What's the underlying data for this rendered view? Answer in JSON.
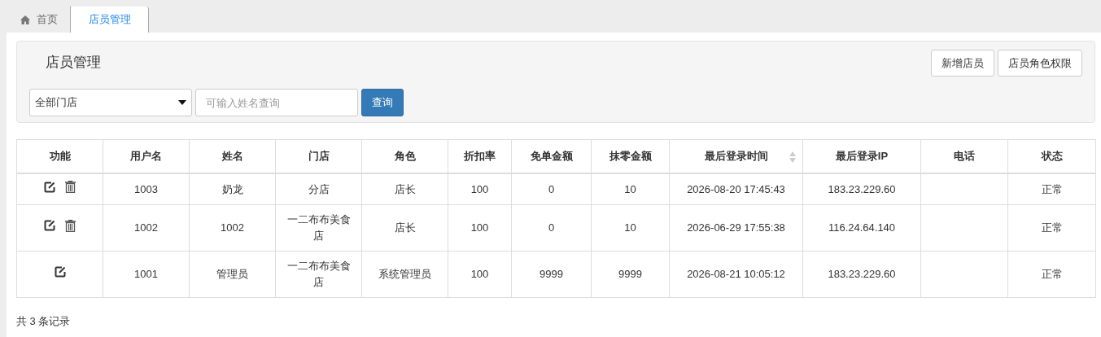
{
  "tabs": [
    {
      "label": "首页",
      "selected": false
    },
    {
      "label": "店员管理",
      "selected": true
    }
  ],
  "panel": {
    "title": "店员管理",
    "buttons": [
      "新增店员",
      "店员角色权限"
    ],
    "store_select": {
      "value": "全部门店"
    },
    "name_search": {
      "placeholder": "可输入姓名查询"
    },
    "query_button": "查询"
  },
  "table": {
    "columns": [
      {
        "label": "功能"
      },
      {
        "label": "用户名"
      },
      {
        "label": "姓名"
      },
      {
        "label": "门店"
      },
      {
        "label": "角色"
      },
      {
        "label": "折扣率"
      },
      {
        "label": "免单金额"
      },
      {
        "label": "抹零金额"
      },
      {
        "label": "最后登录时间",
        "sortable": true
      },
      {
        "label": "最后登录IP"
      },
      {
        "label": "电话"
      },
      {
        "label": "状态"
      }
    ],
    "rows": [
      {
        "cells": [
          {
            "icons": [
              {
                "kind": "edit"
              },
              {
                "kind": "delete"
              }
            ]
          },
          "1003",
          "奶龙",
          "分店",
          "店长",
          "100",
          "0",
          "10",
          "2026-08-20 17:45:43",
          "183.23.229.60",
          "",
          "正常"
        ]
      },
      {
        "cells": [
          {
            "icons": [
              {
                "kind": "edit"
              },
              {
                "kind": "delete"
              }
            ]
          },
          "1002",
          "1002",
          "一二布布美食店",
          "店长",
          "100",
          "0",
          "10",
          "2026-06-29 17:55:38",
          "116.24.64.140",
          "",
          "正常"
        ]
      },
      {
        "cells": [
          {
            "icons": [
              {
                "kind": "edit"
              }
            ]
          },
          "1001",
          "管理员",
          "一二布布美食店",
          "系统管理员",
          "100",
          "9999",
          "9999",
          "2026-08-21 10:05:12",
          "183.23.229.60",
          "",
          "正常"
        ]
      }
    ]
  },
  "footer": "共 3 条记录"
}
